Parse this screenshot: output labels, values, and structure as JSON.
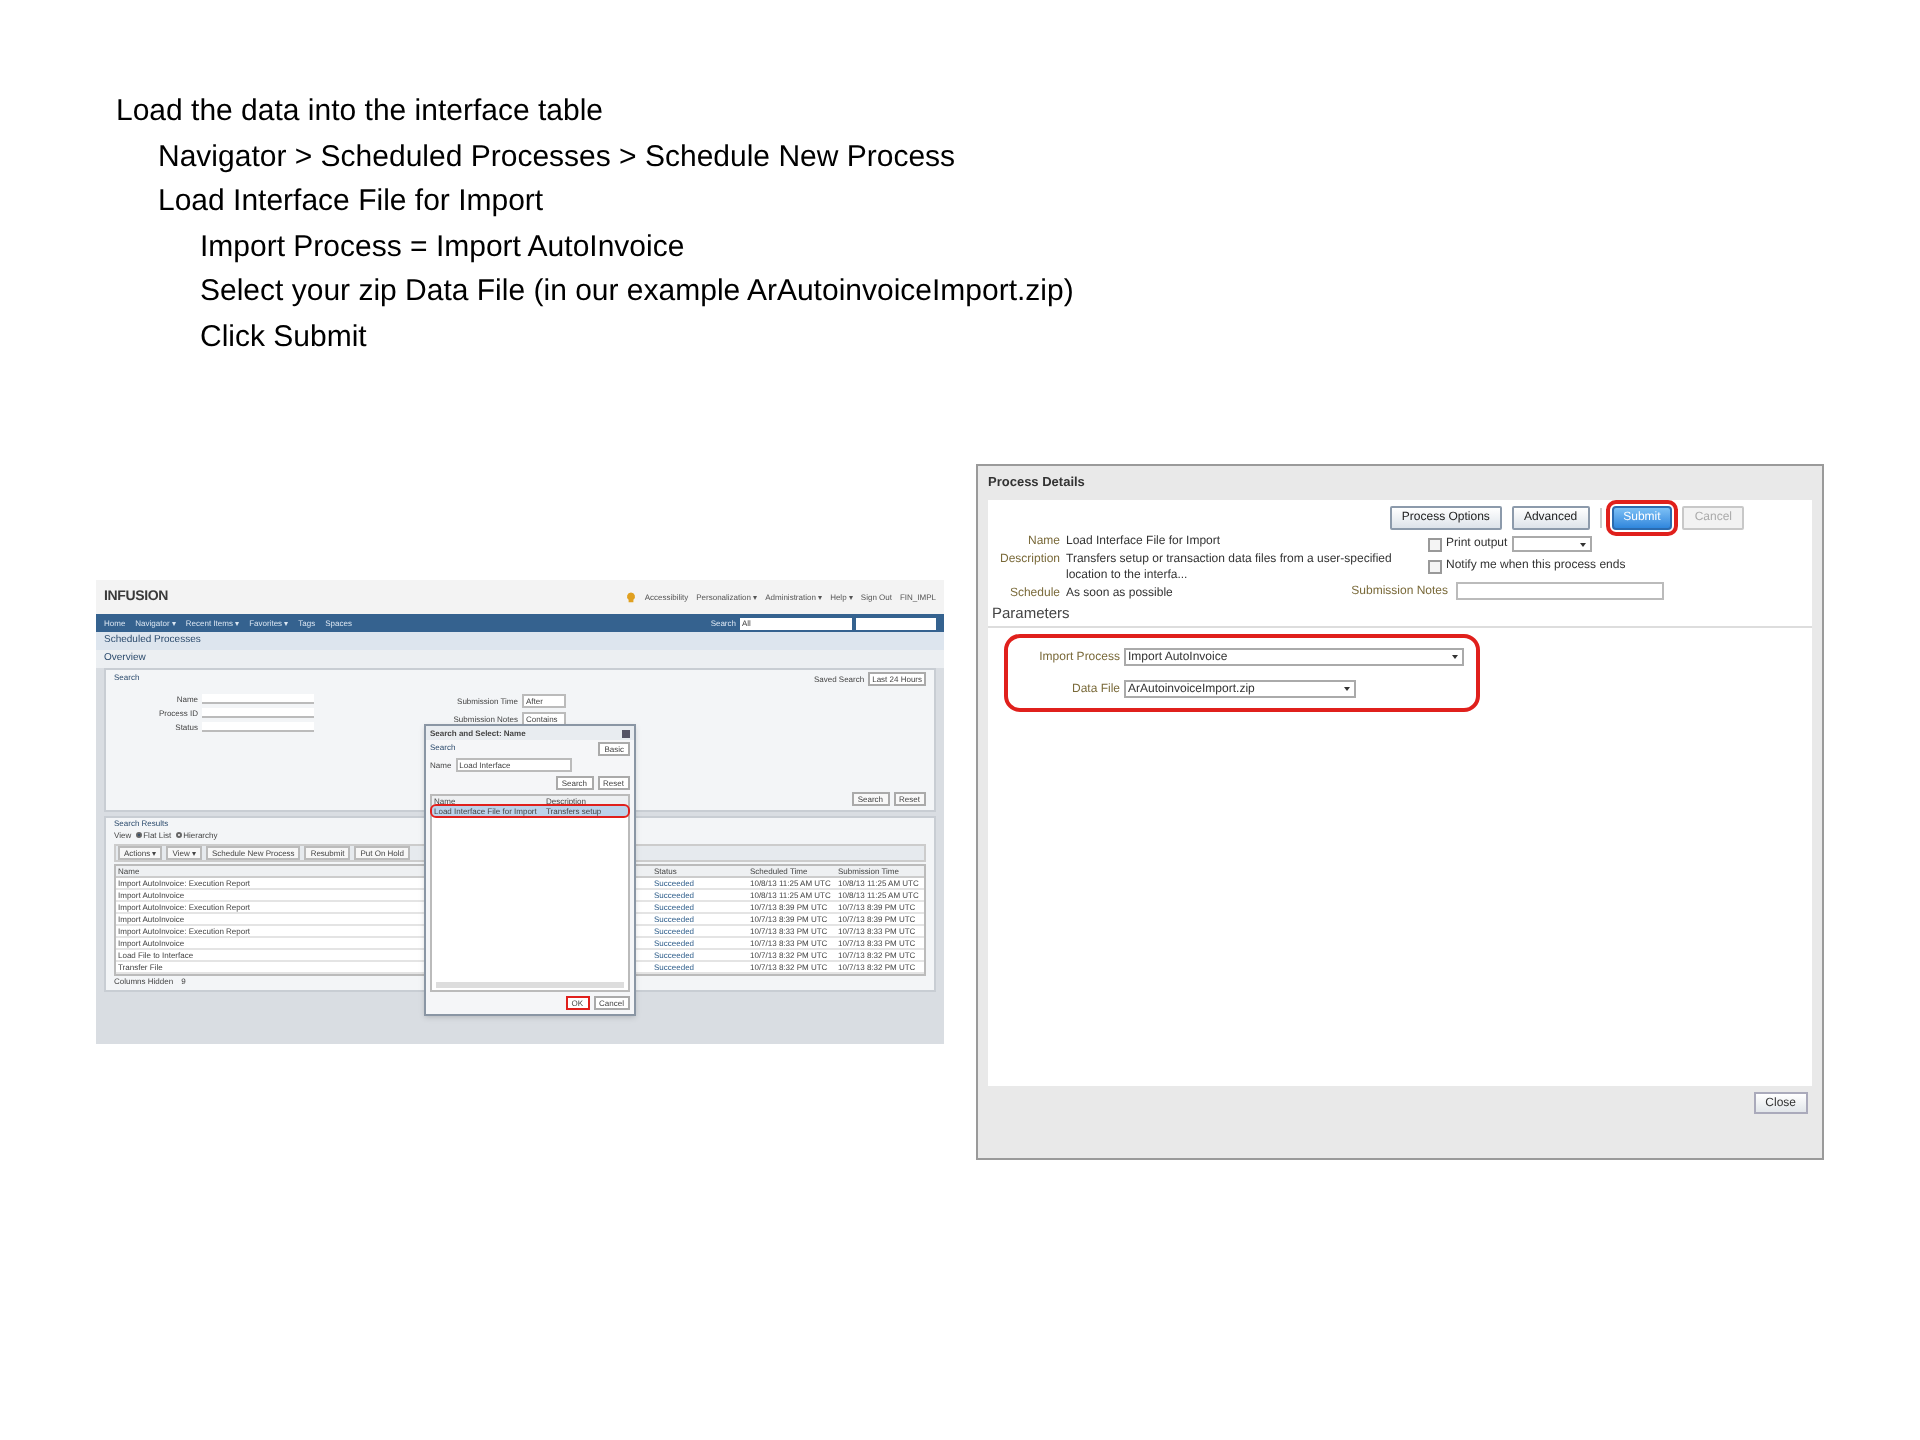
{
  "instructions": [
    {
      "text": "Load the data into the interface table",
      "children": [
        {
          "text": "Navigator > Scheduled Processes > Schedule New Process"
        },
        {
          "text": "Load Interface File for Import",
          "children": [
            {
              "text": "Import Process = Import AutoInvoice"
            },
            {
              "text": "Select your zip Data File (in our example ArAutoinvoiceImport.zip)"
            },
            {
              "text": "Click Submit"
            }
          ]
        }
      ]
    }
  ],
  "scheduled_processes_screenshot": {
    "logo": "INFUSION",
    "header_links": [
      "Accessibility",
      "Personalization ▾",
      "Administration ▾",
      "Help ▾",
      "Sign Out",
      "FIN_IMPL"
    ],
    "nav_items": [
      "Home",
      "Navigator ▾",
      "Recent Items ▾",
      "Favorites ▾",
      "Tags",
      "Spaces"
    ],
    "nav_search": {
      "label": "Search",
      "value": "All"
    },
    "page_title": "Scheduled Processes",
    "overview_title": "Overview",
    "search": {
      "title": "Search",
      "saved_search_label": "Saved Search",
      "saved_search_value": "Last 24 Hours",
      "fields": [
        {
          "label": "Name"
        },
        {
          "label": "Process ID"
        },
        {
          "label": "Status"
        }
      ],
      "right_fields": [
        {
          "label": "Submission Time",
          "value": "After"
        },
        {
          "label": "Submission Notes",
          "value": "Contains"
        }
      ],
      "buttons": [
        "Search",
        "Reset"
      ]
    },
    "results": {
      "title": "Search Results",
      "view_label": "View",
      "view_options": [
        {
          "label": "Flat List",
          "selected": true
        },
        {
          "label": "Hierarchy",
          "selected": false
        }
      ],
      "toolbar": [
        "Actions ▾",
        "View ▾",
        "Schedule New Process",
        "Resubmit",
        "Put On Hold"
      ],
      "columns": [
        "Name",
        "Status",
        "Scheduled Time",
        "Submission Time"
      ],
      "rows": [
        {
          "name": "Import AutoInvoice: Execution Report",
          "status": "Succeeded",
          "scheduled": "10/8/13 11:25 AM UTC",
          "submitted": "10/8/13 11:25 AM UTC"
        },
        {
          "name": "Import AutoInvoice",
          "status": "Succeeded",
          "scheduled": "10/8/13 11:25 AM UTC",
          "submitted": "10/8/13 11:25 AM UTC"
        },
        {
          "name": "Import AutoInvoice: Execution Report",
          "status": "Succeeded",
          "scheduled": "10/7/13 8:39 PM UTC",
          "submitted": "10/7/13 8:39 PM UTC"
        },
        {
          "name": "Import AutoInvoice",
          "status": "Succeeded",
          "scheduled": "10/7/13 8:39 PM UTC",
          "submitted": "10/7/13 8:39 PM UTC"
        },
        {
          "name": "Import AutoInvoice: Execution Report",
          "status": "Succeeded",
          "scheduled": "10/7/13 8:33 PM UTC",
          "submitted": "10/7/13 8:33 PM UTC"
        },
        {
          "name": "Import AutoInvoice",
          "status": "Succeeded",
          "scheduled": "10/7/13 8:33 PM UTC",
          "submitted": "10/7/13 8:33 PM UTC"
        },
        {
          "name": "Load File to Interface",
          "status": "Succeeded",
          "scheduled": "10/7/13 8:32 PM UTC",
          "submitted": "10/7/13 8:32 PM UTC"
        },
        {
          "name": "Transfer File",
          "status": "Succeeded",
          "scheduled": "10/7/13 8:32 PM UTC",
          "submitted": "10/7/13 8:32 PM UTC"
        }
      ],
      "footer_label": "Columns Hidden",
      "footer_value": "9"
    },
    "dialog": {
      "title": "Search and Select: Name",
      "search_title": "Search",
      "mode_button": "Basic",
      "name_label": "Name",
      "name_value": "Load Interface",
      "buttons": [
        "Search",
        "Reset"
      ],
      "columns": [
        "Name",
        "Description"
      ],
      "rows": [
        {
          "name": "Load Interface File for Import",
          "description": "Transfers setup",
          "selected": true,
          "highlighted": true
        }
      ],
      "ok": {
        "label": "OK",
        "highlighted": true
      },
      "cancel": "Cancel"
    }
  },
  "process_details_dialog": {
    "title": "Process Details",
    "buttons": [
      {
        "label": "Process Options",
        "kind": "normal",
        "highlighted": false
      },
      {
        "label": "Advanced",
        "kind": "normal",
        "highlighted": false
      },
      {
        "label": "Submit",
        "kind": "primary",
        "highlighted": true
      },
      {
        "label": "Cancel",
        "kind": "disabled",
        "highlighted": false
      }
    ],
    "details": [
      {
        "label": "Name",
        "value": "Load Interface File for Import"
      },
      {
        "label": "Description",
        "value": "Transfers setup or transaction data files from a user-specified location to the interfa..."
      },
      {
        "label": "Schedule",
        "value": "As soon as possible"
      }
    ],
    "options": [
      {
        "label": "Print output",
        "checked": false,
        "kind": "select"
      },
      {
        "label": "Notify me when this process ends",
        "checked": false,
        "kind": "plain"
      }
    ],
    "notes_label": "Submission Notes",
    "parameters_title": "Parameters",
    "parameters_highlighted": true,
    "parameters": [
      {
        "label": "Import Process",
        "value": "Import AutoInvoice"
      },
      {
        "label": "Data File",
        "value": "ArAutoinvoiceImport.zip"
      }
    ],
    "close": "Close"
  }
}
